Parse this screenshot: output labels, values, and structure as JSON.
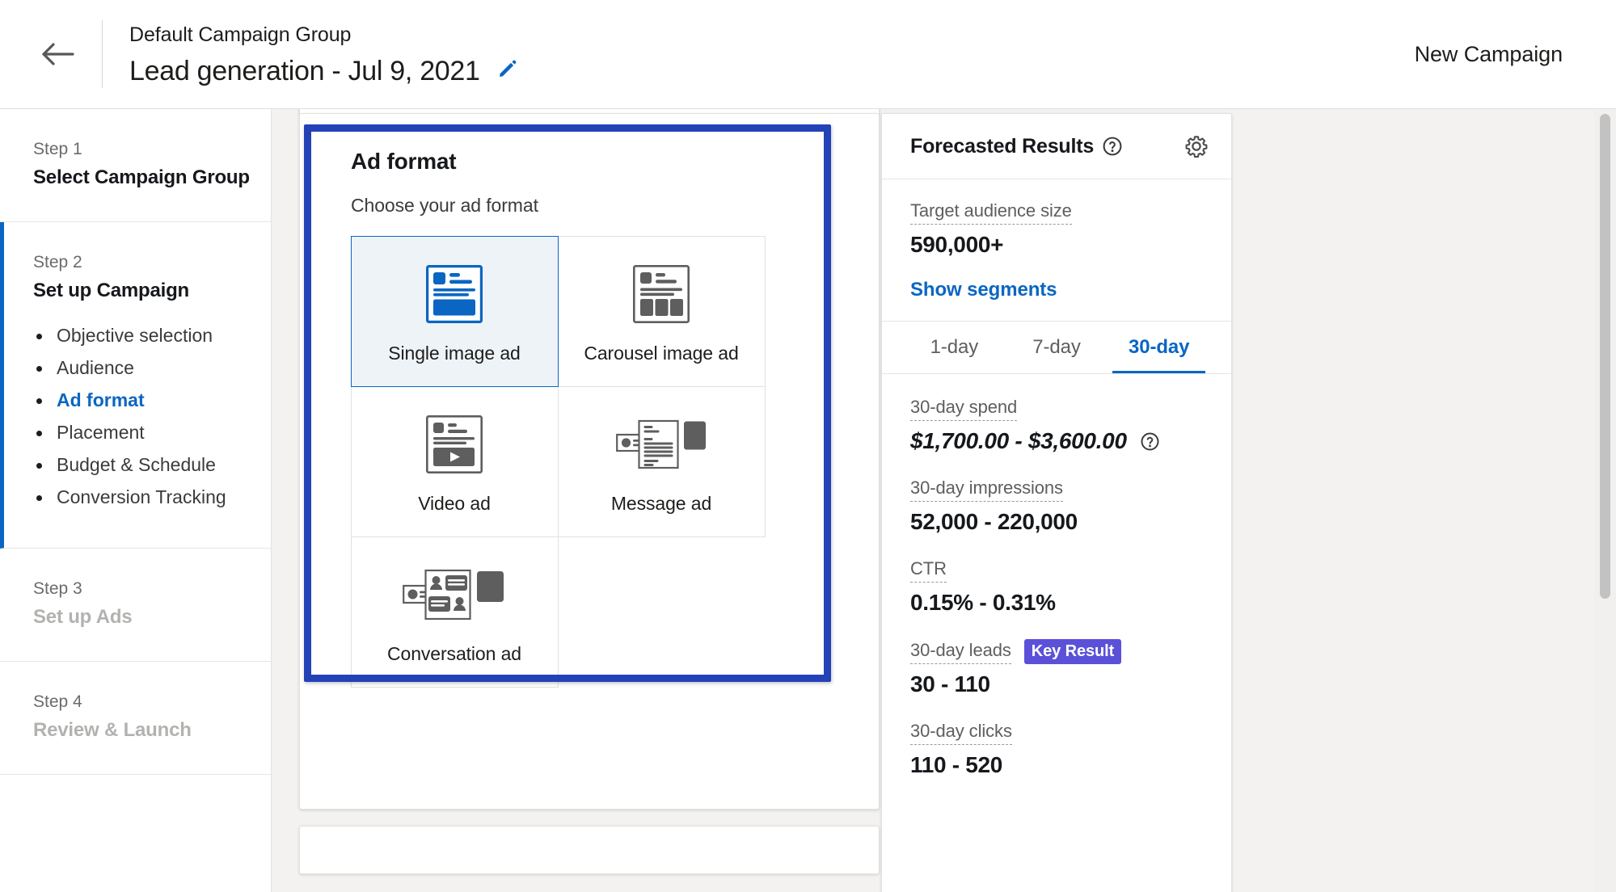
{
  "header": {
    "back_icon": "arrow-left-icon",
    "breadcrumb": "Default Campaign Group",
    "title": "Lead generation - Jul 9, 2021",
    "edit_icon": "pencil-icon",
    "right_label": "New Campaign"
  },
  "sidebar": {
    "steps": [
      {
        "eyebrow": "Step 1",
        "name": "Select Campaign Group",
        "state": "done",
        "substeps": []
      },
      {
        "eyebrow": "Step 2",
        "name": "Set up Campaign",
        "state": "active",
        "substeps": [
          {
            "label": "Objective selection",
            "current": false
          },
          {
            "label": "Audience",
            "current": false
          },
          {
            "label": "Ad format",
            "current": true
          },
          {
            "label": "Placement",
            "current": false
          },
          {
            "label": "Budget & Schedule",
            "current": false
          },
          {
            "label": "Conversion Tracking",
            "current": false
          }
        ]
      },
      {
        "eyebrow": "Step 3",
        "name": "Set up Ads",
        "state": "disabled",
        "substeps": []
      },
      {
        "eyebrow": "Step 4",
        "name": "Review & Launch",
        "state": "disabled",
        "substeps": []
      }
    ]
  },
  "ad_format_card": {
    "title": "Ad format",
    "subtitle": "Choose your ad format",
    "highlighted": true,
    "highlight_color": "#2442b8",
    "selected_format": "Single image ad",
    "formats": [
      {
        "label": "Single image ad",
        "icon": "single-image-ad-icon",
        "selected": true
      },
      {
        "label": "Carousel image ad",
        "icon": "carousel-image-ad-icon",
        "selected": false
      },
      {
        "label": "Video ad",
        "icon": "video-ad-icon",
        "selected": false
      },
      {
        "label": "Message ad",
        "icon": "message-ad-icon",
        "selected": false
      },
      {
        "label": "Conversation ad",
        "icon": "conversation-ad-icon",
        "selected": false
      }
    ]
  },
  "forecast": {
    "title": "Forecasted Results",
    "title_info_icon": "help-circle-icon",
    "settings_icon": "gear-icon",
    "audience": {
      "label": "Target audience size",
      "value": "590,000+",
      "link": "Show segments"
    },
    "tabs": [
      {
        "label": "1-day",
        "active": false
      },
      {
        "label": "7-day",
        "active": false
      },
      {
        "label": "30-day",
        "active": true
      }
    ],
    "metrics": [
      {
        "label": "30-day spend",
        "value": "$1,700.00 - $3,600.00",
        "italic": true,
        "info_icon": "help-circle-icon",
        "badge": ""
      },
      {
        "label": "30-day impressions",
        "value": "52,000 - 220,000",
        "italic": false,
        "info_icon": "",
        "badge": ""
      },
      {
        "label": "CTR",
        "value": "0.15% - 0.31%",
        "italic": false,
        "info_icon": "",
        "badge": ""
      },
      {
        "label": "30-day leads",
        "value": "30 - 110",
        "italic": false,
        "info_icon": "",
        "badge": "Key Result"
      },
      {
        "label": "30-day clicks",
        "value": "110 - 520",
        "italic": false,
        "info_icon": "",
        "badge": ""
      }
    ]
  },
  "colors": {
    "accent_blue": "#0a66c2",
    "highlight_blue": "#2442b8",
    "badge_purple": "#5b51d8",
    "page_bg": "#f3f2f0"
  }
}
